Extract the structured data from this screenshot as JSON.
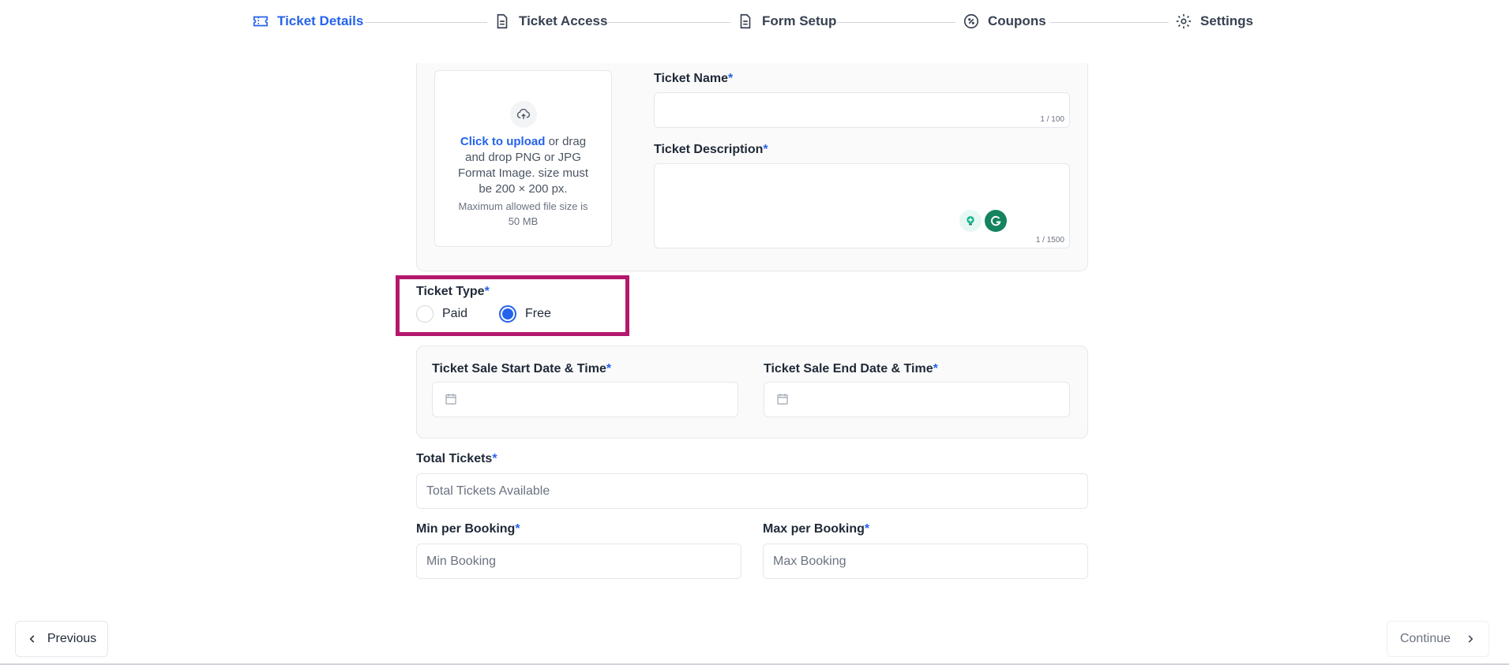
{
  "stepper": {
    "steps": [
      {
        "label": "Ticket Details",
        "icon": "ticket-icon",
        "active": true
      },
      {
        "label": "Ticket Access",
        "icon": "document-icon",
        "active": false
      },
      {
        "label": "Form Setup",
        "icon": "document-icon",
        "active": false
      },
      {
        "label": "Coupons",
        "icon": "coupon-icon",
        "active": false
      },
      {
        "label": "Settings",
        "icon": "gear-icon",
        "active": false
      }
    ]
  },
  "upload": {
    "link_text": "Click to upload",
    "text": "or drag and drop PNG or JPG Format Image. size must be 200 × 200 px.",
    "small_text": "Maximum allowed file size is 50 MB"
  },
  "ticket_name": {
    "label": "Ticket Name",
    "required": "*",
    "value": "",
    "counter": "1 / 100"
  },
  "ticket_description": {
    "label": "Ticket Description",
    "required": "*",
    "value": "",
    "counter": "1 / 1500"
  },
  "ticket_type": {
    "label": "Ticket Type",
    "required": "*",
    "options": [
      {
        "label": "Paid",
        "checked": false
      },
      {
        "label": "Free",
        "checked": true
      }
    ]
  },
  "sale_start": {
    "label": "Ticket Sale Start Date & Time",
    "required": "*",
    "value": ""
  },
  "sale_end": {
    "label": "Ticket Sale End Date & Time",
    "required": "*",
    "value": ""
  },
  "total_tickets": {
    "label": "Total Tickets",
    "required": "*",
    "placeholder": "Total Tickets Available"
  },
  "min_booking": {
    "label": "Min per Booking",
    "required": "*",
    "placeholder": "Min Booking"
  },
  "max_booking": {
    "label": "Max per Booking",
    "required": "*",
    "placeholder": "Max Booking"
  },
  "footer": {
    "previous_label": "Previous",
    "continue_label": "Continue"
  },
  "colors": {
    "accent": "#2563eb",
    "highlight": "#b3186d"
  }
}
